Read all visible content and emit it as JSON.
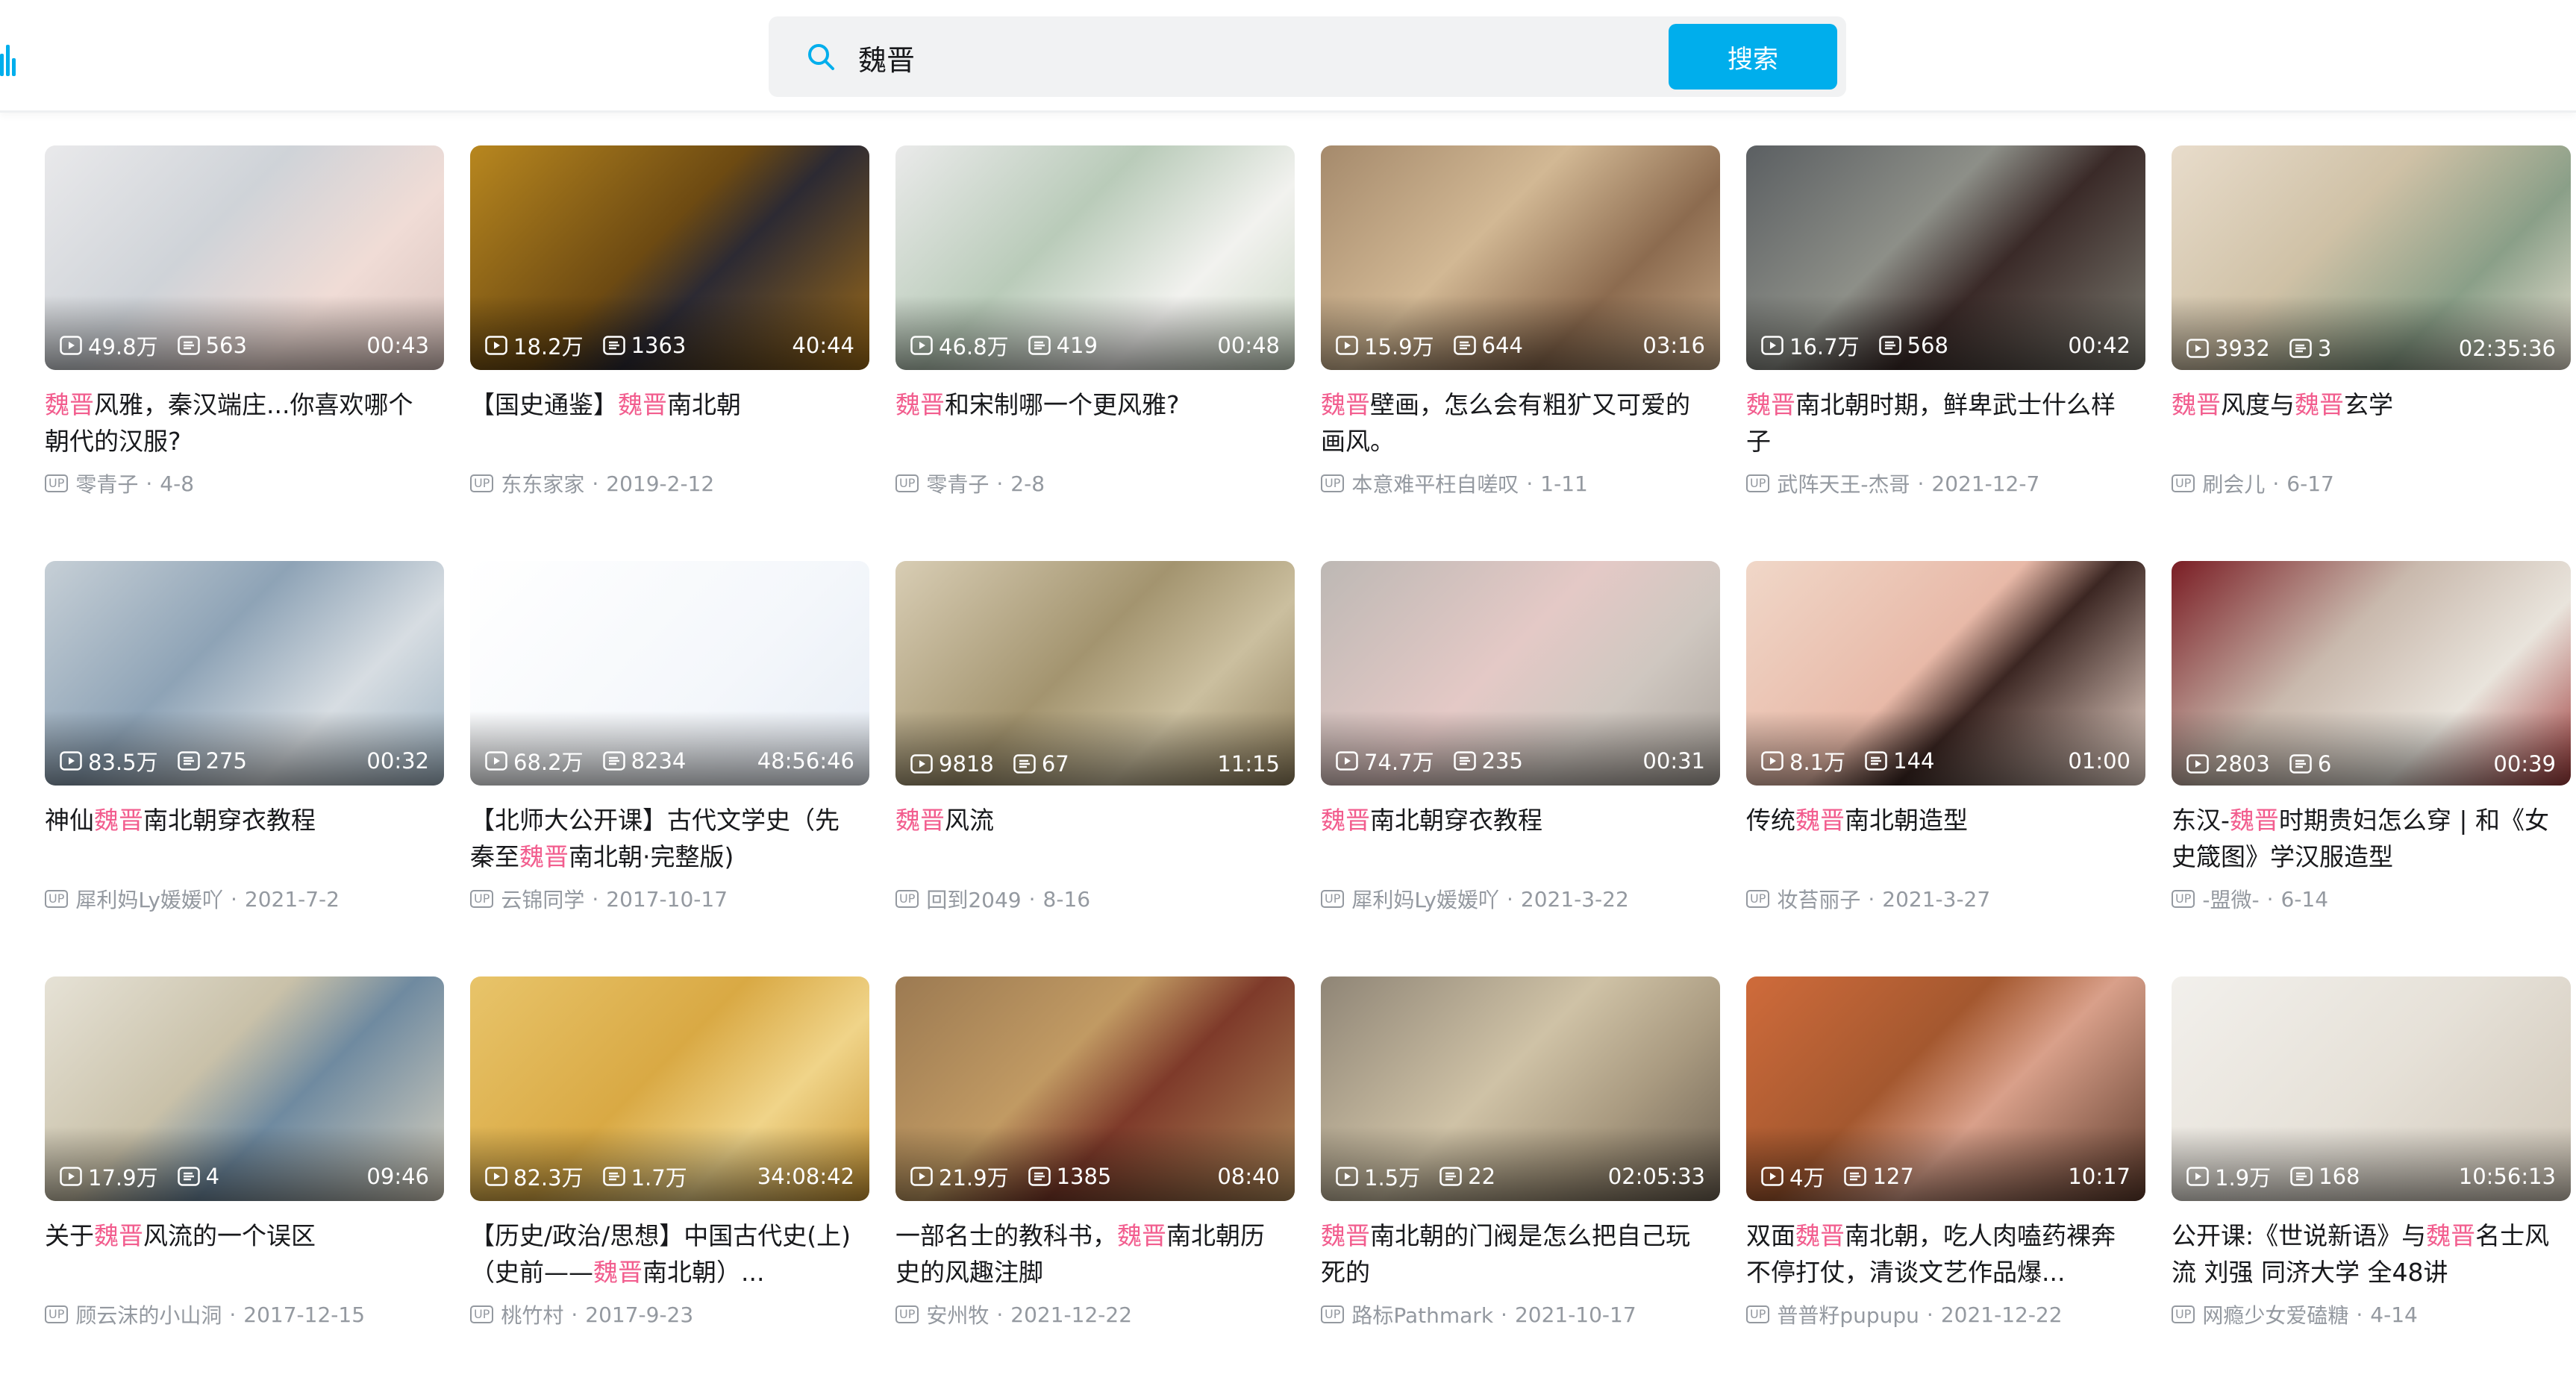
{
  "search": {
    "query": "魏晋",
    "button_label": "搜索"
  },
  "colors": {
    "accent": "#00aeec",
    "highlight": "#f25d8e",
    "meta": "#9499a0"
  },
  "videos": [
    {
      "title_parts": [
        {
          "t": "魏晋",
          "hl": true
        },
        {
          "t": "风雅，秦汉端庄...你喜欢哪个朝代的汉服?",
          "hl": false
        }
      ],
      "views": "49.8万",
      "danmaku": "563",
      "duration": "00:43",
      "author": "零青子",
      "date": "4-8",
      "bg": "linear-gradient(135deg,#e9e9eb 0%,#cfd3d8 40%,#f0dcd6 70%,#d9c3bd 100%)"
    },
    {
      "title_parts": [
        {
          "t": "【国史通鉴】",
          "hl": false
        },
        {
          "t": "魏晋",
          "hl": true
        },
        {
          "t": "南北朝",
          "hl": false
        }
      ],
      "views": "18.2万",
      "danmaku": "1363",
      "duration": "40:44",
      "author": "东东家家",
      "date": "2019-2-12",
      "bg": "linear-gradient(135deg,#b8871f 0%,#6d4a12 45%,#2c2a33 60%,#9c6a18 100%)"
    },
    {
      "title_parts": [
        {
          "t": "魏晋",
          "hl": true
        },
        {
          "t": "和宋制哪一个更风雅?",
          "hl": false
        }
      ],
      "views": "46.8万",
      "danmaku": "419",
      "duration": "00:48",
      "author": "零青子",
      "date": "2-8",
      "bg": "linear-gradient(135deg,#eaeaea 0%,#b9cbb9 40%,#f2f2ef 70%,#c9d6c4 100%)"
    },
    {
      "title_parts": [
        {
          "t": "魏晋",
          "hl": true
        },
        {
          "t": "壁画，怎么会有粗犷又可爱的画风。",
          "hl": false
        }
      ],
      "views": "15.9万",
      "danmaku": "644",
      "duration": "03:16",
      "author": "本意难平枉自嗟叹",
      "date": "1-11",
      "bg": "linear-gradient(135deg,#a58a6c 0%,#d2b894 40%,#8c6b4f 70%,#c7a987 100%)"
    },
    {
      "title_parts": [
        {
          "t": "魏晋",
          "hl": true
        },
        {
          "t": "南北朝时期，鲜卑武士什么样子",
          "hl": false
        }
      ],
      "views": "16.7万",
      "danmaku": "568",
      "duration": "00:42",
      "author": "武阵天王-杰哥",
      "date": "2021-12-7",
      "bg": "linear-gradient(135deg,#5b5f62 0%,#8d8f88 40%,#3a2a28 60%,#7c7b71 100%)"
    },
    {
      "title_parts": [
        {
          "t": "魏晋",
          "hl": true
        },
        {
          "t": "风度与",
          "hl": false
        },
        {
          "t": "魏晋",
          "hl": true
        },
        {
          "t": "玄学",
          "hl": false
        }
      ],
      "views": "3932",
      "danmaku": "3",
      "duration": "02:35:36",
      "author": "刷会儿",
      "date": "6-17",
      "bg": "linear-gradient(135deg,#e8dccb 0%,#cfc1a6 40%,#8a9f88 70%,#e9e2d3 100%)"
    },
    {
      "title_parts": [
        {
          "t": "神仙",
          "hl": false
        },
        {
          "t": "魏晋",
          "hl": true
        },
        {
          "t": "南北朝穿衣教程",
          "hl": false
        }
      ],
      "views": "83.5万",
      "danmaku": "275",
      "duration": "00:32",
      "author": "犀利妈Ly媛媛吖",
      "date": "2021-7-2",
      "bg": "linear-gradient(135deg,#c6cfd6 0%,#8ea3b6 40%,#d7dde2 70%,#9fb3c2 100%)"
    },
    {
      "title_parts": [
        {
          "t": "【北师大公开课】古代文学史（先秦至",
          "hl": false
        },
        {
          "t": "魏晋",
          "hl": true
        },
        {
          "t": "南北朝·完整版)",
          "hl": false
        }
      ],
      "views": "68.2万",
      "danmaku": "8234",
      "duration": "48:56:46",
      "author": "云锦同学",
      "date": "2017-10-17",
      "bg": "linear-gradient(135deg,#ffffff 0%,#f4f7fb 60%,#e7edf5 100%)"
    },
    {
      "title_parts": [
        {
          "t": "魏晋",
          "hl": true
        },
        {
          "t": "风流",
          "hl": false
        }
      ],
      "views": "9818",
      "danmaku": "67",
      "duration": "11:15",
      "author": "回到2049",
      "date": "8-16",
      "bg": "linear-gradient(135deg,#d8cdb4 0%,#a3946f 45%,#cbbf9f 70%,#8d7d5b 100%)"
    },
    {
      "title_parts": [
        {
          "t": "魏晋",
          "hl": true
        },
        {
          "t": "南北朝穿衣教程",
          "hl": false
        }
      ],
      "views": "74.7万",
      "danmaku": "235",
      "duration": "00:31",
      "author": "犀利妈Ly媛媛吖",
      "date": "2021-3-22",
      "bg": "linear-gradient(135deg,#bdb8b4 0%,#e4c9c6 45%,#cfc7c0 70%,#a9a29b 100%)"
    },
    {
      "title_parts": [
        {
          "t": "传统",
          "hl": false
        },
        {
          "t": "魏晋",
          "hl": true
        },
        {
          "t": "南北朝造型",
          "hl": false
        }
      ],
      "views": "8.1万",
      "danmaku": "144",
      "duration": "01:00",
      "author": "妆苔丽子",
      "date": "2021-3-27",
      "bg": "linear-gradient(135deg,#f0d7c8 0%,#e8b9a8 45%,#3b2622 60%,#f1dcd0 100%)"
    },
    {
      "title_parts": [
        {
          "t": "东汉-",
          "hl": false
        },
        {
          "t": "魏晋",
          "hl": true
        },
        {
          "t": "时期贵妇怎么穿 | 和《女史箴图》学汉服造型",
          "hl": false
        }
      ],
      "views": "2803",
      "danmaku": "6",
      "duration": "00:39",
      "author": "-盟微-",
      "date": "6-14",
      "bg": "linear-gradient(135deg,#7a1d24 0%,#c9b9ad 40%,#e9e4dc 70%,#9f3b3b 100%)"
    },
    {
      "title_parts": [
        {
          "t": "关于",
          "hl": false
        },
        {
          "t": "魏晋",
          "hl": true
        },
        {
          "t": "风流的一个误区",
          "hl": false
        }
      ],
      "views": "17.9万",
      "danmaku": "4",
      "duration": "09:46",
      "author": "顾云沫的小山洞",
      "date": "2017-12-15",
      "bg": "linear-gradient(135deg,#e6e2d6 0%,#c9c1a9 40%,#6f8aa0 60%,#d8d1bf 100%)"
    },
    {
      "title_parts": [
        {
          "t": "【历史/政治/思想】中国古代史(上)（史前——",
          "hl": false
        },
        {
          "t": "魏晋",
          "hl": true
        },
        {
          "t": "南北朝）...",
          "hl": false
        }
      ],
      "views": "82.3万",
      "danmaku": "1.7万",
      "duration": "34:08:42",
      "author": "桃竹村",
      "date": "2017-9-23",
      "bg": "linear-gradient(135deg,#e8c46a 0%,#d9a944 45%,#f0d489 70%,#c99532 100%)"
    },
    {
      "title_parts": [
        {
          "t": "一部名士的教科书，",
          "hl": false
        },
        {
          "t": "魏晋",
          "hl": true
        },
        {
          "t": "南北朝历史的风趣注脚",
          "hl": false
        }
      ],
      "views": "21.9万",
      "danmaku": "1385",
      "duration": "08:40",
      "author": "安州牧",
      "date": "2021-12-22",
      "bg": "linear-gradient(135deg,#9c7a52 0%,#c19a63 40%,#7e3a2a 60%,#b08a5a 100%)"
    },
    {
      "title_parts": [
        {
          "t": "魏晋",
          "hl": true
        },
        {
          "t": "南北朝的门阀是怎么把自己玩死的",
          "hl": false
        }
      ],
      "views": "1.5万",
      "danmaku": "22",
      "duration": "02:05:33",
      "author": "路标Pathmark",
      "date": "2021-10-17",
      "bg": "linear-gradient(135deg,#8f8576 0%,#cfc2a6 45%,#a99a80 70%,#6d6152 100%)"
    },
    {
      "title_parts": [
        {
          "t": "双面",
          "hl": false
        },
        {
          "t": "魏晋",
          "hl": true
        },
        {
          "t": "南北朝，吃人肉嗑药裸奔不停打仗，清谈文艺作品爆...",
          "hl": false
        }
      ],
      "views": "4万",
      "danmaku": "127",
      "duration": "10:17",
      "author": "普普籽pupupu",
      "date": "2021-12-22",
      "bg": "linear-gradient(135deg,#cf6b3b 0%,#a4582f 40%,#d9a08a 60%,#5d3a2b 100%)"
    },
    {
      "title_parts": [
        {
          "t": "公开课:《世说新语》与",
          "hl": false
        },
        {
          "t": "魏晋",
          "hl": true
        },
        {
          "t": "名士风流 刘强 同济大学 全48讲",
          "hl": false
        }
      ],
      "views": "1.9万",
      "danmaku": "168",
      "duration": "10:56:13",
      "author": "网瘾少女爱磕糖",
      "date": "4-14",
      "bg": "linear-gradient(135deg,#f2f0ec 0%,#e6e1d8 50%,#cfc6b7 100%)"
    }
  ]
}
